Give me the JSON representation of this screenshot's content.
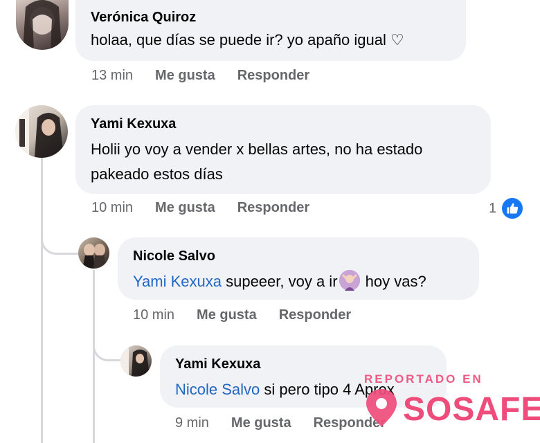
{
  "comments": [
    {
      "author": "Verónica Quiroz",
      "text": "holaa, que días se puede ir? yo apaño igual ♡",
      "time": "13 min",
      "like_label": "Me gusta",
      "reply_label": "Responder"
    },
    {
      "author": "Yami Kexuxa",
      "text_line1": "Holii yo voy a vender x bellas artes, no ha estado",
      "text_line2": "pakeado estos días",
      "time": "10 min",
      "like_label": "Me gusta",
      "reply_label": "Responder",
      "reaction_count": "1",
      "reaction_icon": "like-thumb-icon"
    },
    {
      "author": "Nicole Salvo",
      "mention": "Yami Kexuxa",
      "text_before_emoji": " supeeer, voy a ir",
      "emoji_icon": "person-gesturing-no-emoji",
      "text_after_emoji": " hoy vas?",
      "time": "10 min",
      "like_label": "Me gusta",
      "reply_label": "Responder"
    },
    {
      "author": "Yami Kexuxa",
      "mention": "Nicole Salvo",
      "text": " si pero tipo 4 Aprox",
      "time": "9 min",
      "like_label": "Me gusta",
      "reply_label": "Responder"
    }
  ],
  "watermark": {
    "tagline": "REPORTADO EN",
    "brand": "SOSAFE",
    "icon": "location-pin-icon",
    "color": "#ee4d7b"
  },
  "colors": {
    "bubble": "#f0f2f5",
    "mention": "#1f66c5",
    "like_badge": "#1877f2",
    "meta_text": "#65676b"
  }
}
